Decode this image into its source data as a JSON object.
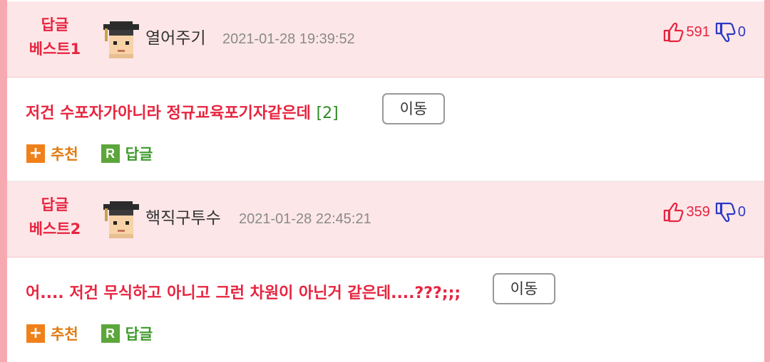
{
  "comments": [
    {
      "badge_line1": "답글",
      "badge_line2": "베스트1",
      "avatar_icon": "graduate-avatar-icon",
      "nickname": "열어주기",
      "date": "2021-01-28 19:39:52",
      "likes": "591",
      "dislikes": "0",
      "text": "저건 수포자가아니라 정규교육포기자같은데",
      "reply_count": "[2]",
      "move_label": "이동",
      "recommend_label": "추천",
      "reply_label": "답글",
      "recommend_icon": "+",
      "reply_icon": "R"
    },
    {
      "badge_line1": "답글",
      "badge_line2": "베스트2",
      "avatar_icon": "graduate-avatar-icon",
      "nickname": "핵직구투수",
      "date": "2021-01-28 22:45:21",
      "likes": "359",
      "dislikes": "0",
      "text": "어.... 저건 무식하고 아니고 그런 차원이 아닌거 같은데....???;;;",
      "move_label": "이동",
      "recommend_label": "추천",
      "reply_label": "답글",
      "recommend_icon": "+",
      "reply_icon": "R"
    }
  ],
  "colors": {
    "accent_red": "#e7243f",
    "header_bg": "#fde6e8",
    "frame_pink": "#f7a9b1",
    "like_red": "#e7243f",
    "dislike_blue": "#2b39c7",
    "recommend_orange": "#f0801a",
    "reply_green": "#5ca63b"
  },
  "icons": {
    "like": "thumbs-up-icon",
    "dislike": "thumbs-down-icon"
  }
}
